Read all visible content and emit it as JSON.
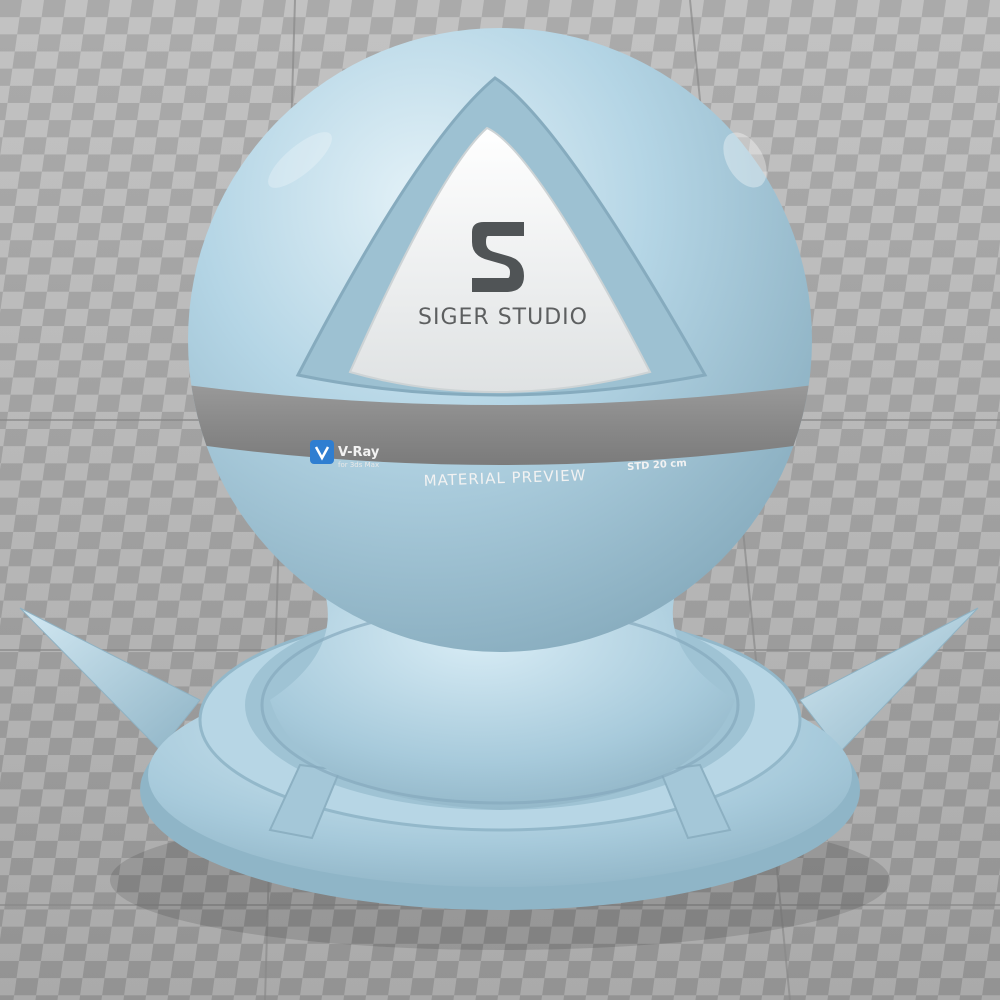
{
  "logo": {
    "studio_name": "SIGER STUDIO",
    "mark": "S"
  },
  "band": {
    "vray_brand": "V-Ray",
    "vray_sub": "for 3ds Max",
    "preview_label": "MATERIAL PREVIEW",
    "size_label": "STD 20 cm"
  },
  "colors": {
    "material": "#a9ccdd",
    "material_light": "#d6ebf4",
    "material_dark": "#7fa6b9",
    "band": "#8e8e8e",
    "band_text": "#f2f2f2",
    "panel": "#eef0f0",
    "logo_text": "#5d5f60",
    "vray_badge": "#2f7ed1",
    "checker_light": "#bcbcbc",
    "checker_dark": "#9d9d9d"
  }
}
